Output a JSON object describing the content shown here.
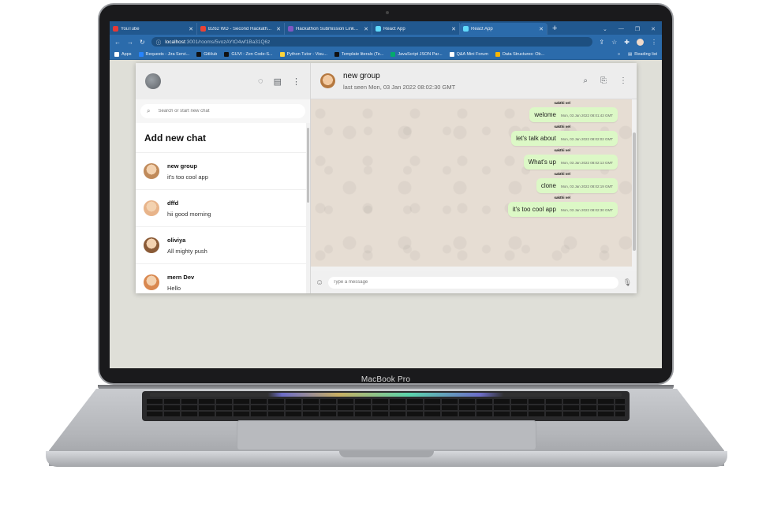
{
  "device": {
    "label": "MacBook Pro"
  },
  "browser": {
    "tabs": [
      {
        "title": "YouTube",
        "color": "#e53935",
        "active": false
      },
      {
        "title": "B262 WD - Second Hackath...",
        "color": "#ea4335",
        "active": false
      },
      {
        "title": "Hackathon Submission Link...",
        "color": "#7e57c2",
        "active": false
      },
      {
        "title": "React App",
        "color": "#61dafb",
        "active": false
      },
      {
        "title": "React App",
        "color": "#61dafb",
        "active": true
      }
    ],
    "new_tab_label": "+",
    "url": {
      "host": "localhost",
      "path": ":3001/rooms/5vozAYtO4wf1Ba31Q6z"
    },
    "bookmarks": [
      {
        "label": "Apps",
        "color": "#ffffff"
      },
      {
        "label": "Requests - Jira Servi...",
        "color": "#2684ff"
      },
      {
        "label": "GitHub",
        "color": "#111111"
      },
      {
        "label": "GUVI : Zen Code-S...",
        "color": "#111111"
      },
      {
        "label": "Python Tutor - Visu...",
        "color": "#ffd43b"
      },
      {
        "label": "Template literals (Te...",
        "color": "#111111"
      },
      {
        "label": "JavaScript JSON Par...",
        "color": "#04aa6d"
      },
      {
        "label": "Q&A Mini Forum",
        "color": "#ffffff"
      },
      {
        "label": "Data Structures: Ob...",
        "color": "#f7b500"
      }
    ],
    "bookmarks_more": "»",
    "reading_list": "Reading list"
  },
  "sidebar": {
    "search_placeholder": "Search or start new chat",
    "add_new_chat": "Add new chat",
    "chats": [
      {
        "name": "new group",
        "last": "it's too cool app",
        "avatar_color": "#c08a5a"
      },
      {
        "name": "dffd",
        "last": "hii good morning",
        "avatar_color": "#e8b48a"
      },
      {
        "name": "oliviya",
        "last": "All mighty push",
        "avatar_color": "#8a5a36"
      },
      {
        "name": "mern Dev",
        "last": "Hello",
        "avatar_color": "#d9884f"
      }
    ]
  },
  "chat": {
    "name": "new group",
    "last_seen": "last seen Mon, 03 Jan 2022 08:02:30 GMT",
    "messages": [
      {
        "sender": "sakthi vel",
        "text": "welome",
        "time": "Mon, 03 Jan 2022 08:01:43 GMT"
      },
      {
        "sender": "sakthi vel",
        "text": "let's talk about",
        "time": "Mon, 03 Jan 2022 08:02:02 GMT"
      },
      {
        "sender": "sakthi vel",
        "text": "What's up",
        "time": "Mon, 03 Jan 2022 08:02:13 GMT"
      },
      {
        "sender": "sakthi vel",
        "text": "clone",
        "time": "Mon, 03 Jan 2022 08:02:19 GMT"
      },
      {
        "sender": "sakthi vel",
        "text": "it's too cool app",
        "time": "Mon, 03 Jan 2022 08:02:30 GMT"
      }
    ],
    "input_placeholder": "Type a message"
  }
}
